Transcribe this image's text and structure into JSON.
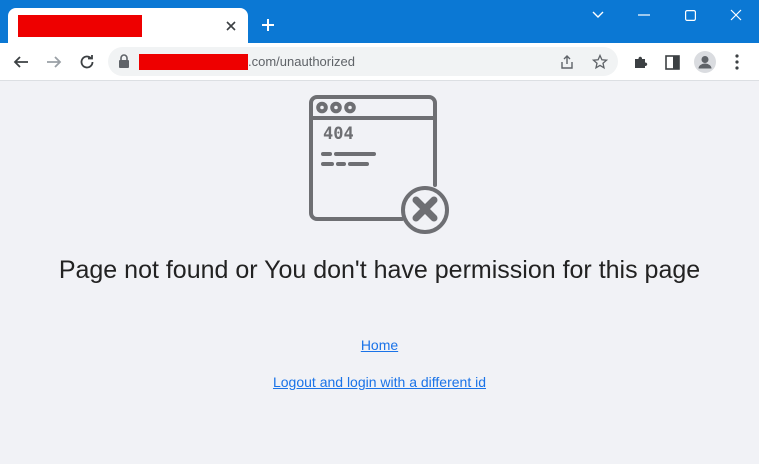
{
  "browser": {
    "tab": {
      "close_icon": "close-icon"
    },
    "new_tab_icon": "plus-icon",
    "window_controls": [
      "chevron-down-icon",
      "minimize-icon",
      "maximize-icon",
      "close-icon"
    ],
    "toolbar": {
      "back_icon": "arrow-left-icon",
      "forward_icon": "arrow-right-icon",
      "reload_icon": "reload-icon",
      "lock_icon": "lock-icon",
      "url_visible_suffix": ".com/unauthorized",
      "share_icon": "share-icon",
      "bookmark_icon": "star-icon",
      "extensions_icon": "puzzle-icon",
      "sidepanel_icon": "side-panel-icon",
      "profile_icon": "profile-icon",
      "menu_icon": "kebab-menu-icon"
    },
    "colors": {
      "titlebar": "#0b78d4",
      "redaction": "#ee0000"
    }
  },
  "page": {
    "illustration": {
      "icon": "browser-window-404-error-icon",
      "text": "404"
    },
    "heading": "Page not found or You don't have permission for this page",
    "links": {
      "home": "Home",
      "logout": "Logout and login with a different id"
    },
    "colors": {
      "background": "#f1f2f6",
      "link": "#1a73e8",
      "illustration": "#6e6f73"
    }
  }
}
